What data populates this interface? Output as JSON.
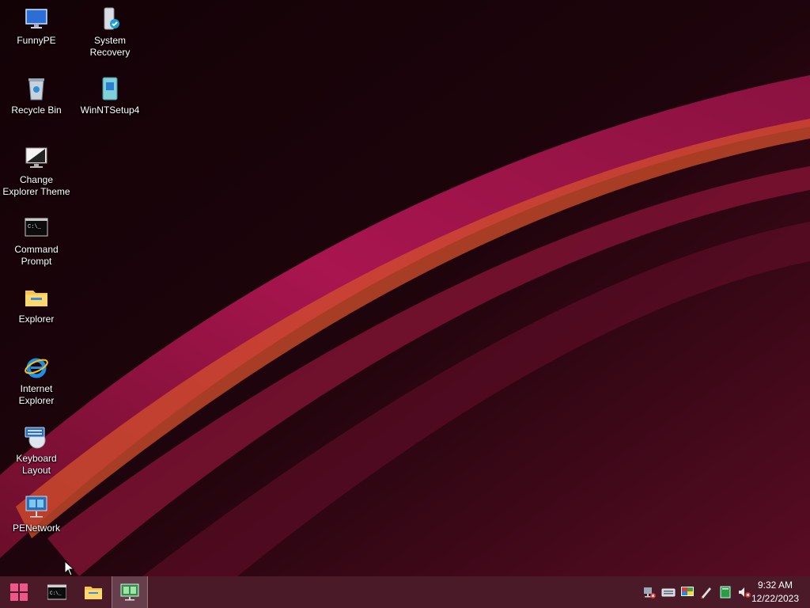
{
  "desktop": {
    "icons": [
      {
        "label": "FunnyPE",
        "icon": "computer-icon"
      },
      {
        "label": "System Recovery",
        "icon": "system-recovery-icon"
      },
      {
        "label": "Recycle Bin",
        "icon": "recycle-bin-icon"
      },
      {
        "label": "WinNTSetup4",
        "icon": "winntsetup-icon"
      },
      {
        "label": "Change Explorer Theme",
        "icon": "monitor-theme-icon"
      },
      {
        "label": "Command Prompt",
        "icon": "command-prompt-icon"
      },
      {
        "label": "Explorer",
        "icon": "folder-icon"
      },
      {
        "label": "Internet Explorer",
        "icon": "internet-explorer-icon"
      },
      {
        "label": "Keyboard Layout",
        "icon": "keyboard-layout-icon"
      },
      {
        "label": "PENetwork",
        "icon": "network-icon"
      }
    ]
  },
  "taskbar": {
    "pinned": [
      {
        "name": "start",
        "icon": "windows-logo-icon"
      },
      {
        "name": "command-prompt",
        "icon": "command-prompt-icon"
      },
      {
        "name": "file-explorer",
        "icon": "folder-icon"
      },
      {
        "name": "penetwork",
        "icon": "network-monitor-icon",
        "active": true
      }
    ],
    "tray_icons": [
      "network-disconnected-icon",
      "keyboard-icon",
      "display-settings-icon",
      "pen-tool-icon",
      "green-app-icon",
      "volume-muted-icon"
    ],
    "clock": {
      "time": "9:32 AM",
      "date": "12/22/2023"
    }
  },
  "colors": {
    "taskbar": "#4a1a29",
    "accent_pink": "#c2185b",
    "start_logo": "#f0568a",
    "wallpaper_dark": "#0f0205"
  }
}
